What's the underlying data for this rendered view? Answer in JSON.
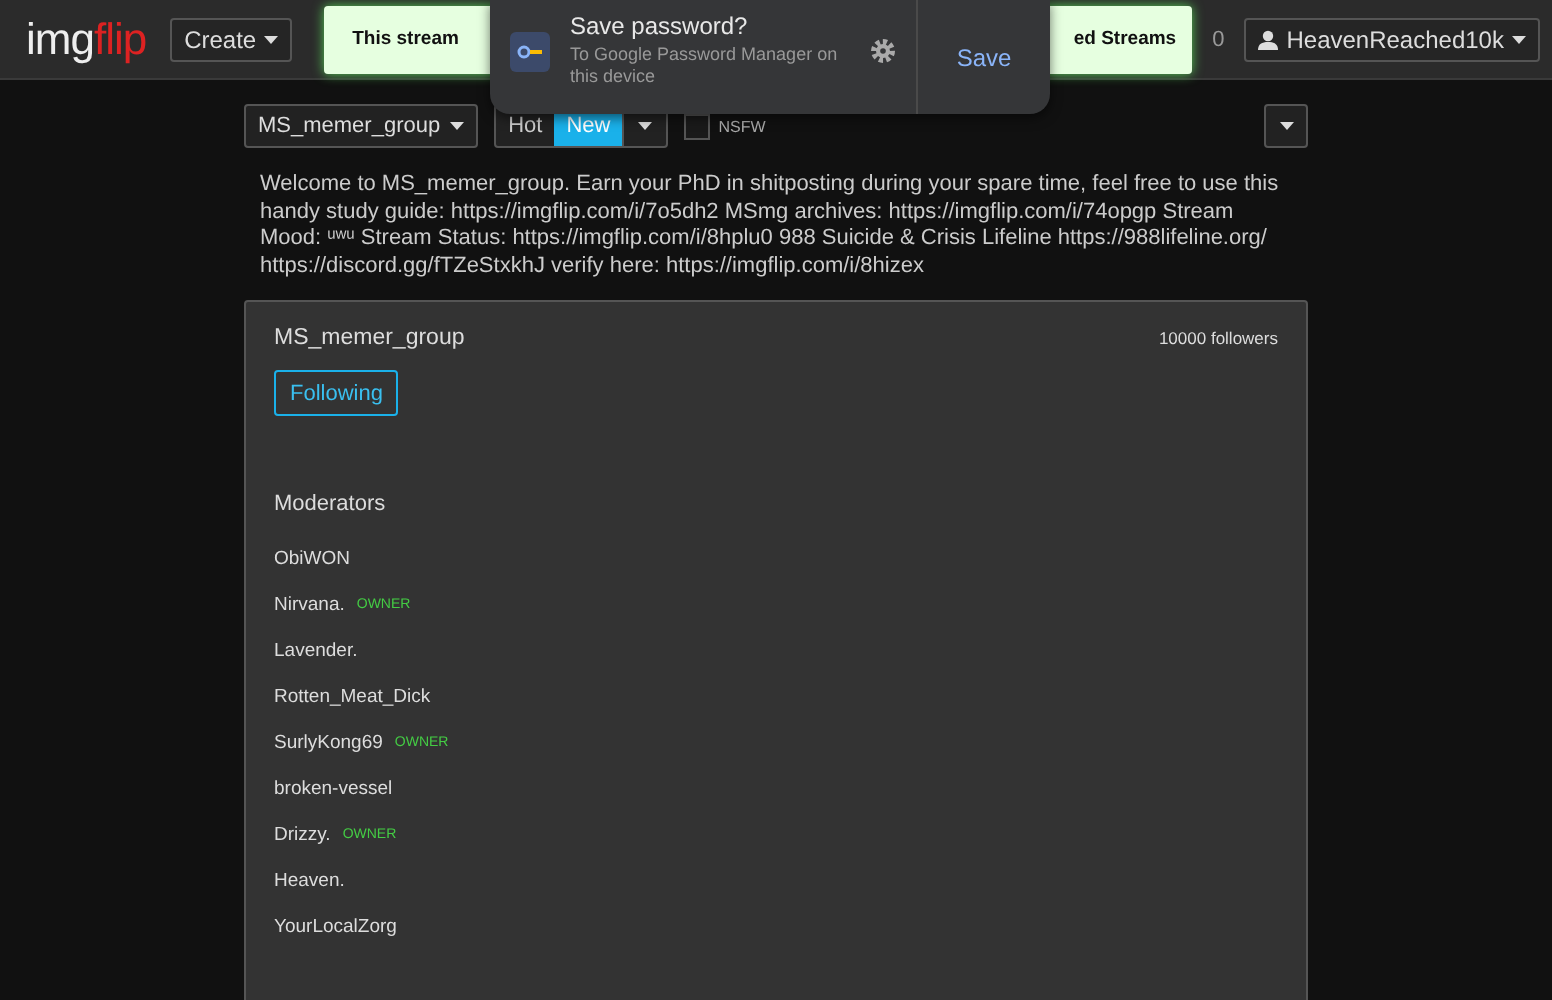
{
  "header": {
    "logo": {
      "part_1": "img",
      "part_2": "flip"
    },
    "create_button": "Create",
    "banner": {
      "text_start": "This stream",
      "text_end": "ed Streams"
    },
    "notification_count": "0",
    "user": "HeavenReached10k"
  },
  "password_popup": {
    "title": "Save password?",
    "subtitle": "To Google Password Manager on this device",
    "save_button": "Save"
  },
  "toolbar": {
    "stream_select": "MS_memer_group",
    "sort_options": [
      {
        "label": "Hot",
        "selected": false
      },
      {
        "label": "New",
        "selected": true
      }
    ],
    "nsfw": {
      "label": "NSFW",
      "checked": false
    }
  },
  "description": "Welcome to MS_memer_group. Earn your PhD in shitposting during your spare time, feel free to use this handy study guide: https://imgflip.com/i/7o5dh2 MSmg archives: https://imgflip.com/i/74opgp Stream Mood: ᵘʷᵘ Stream Status: https://imgflip.com/i/8hplu0 988 Suicide & Crisis Lifeline https://988lifeline.org/ https://discord.gg/fTZeStxkhJ verify here: https://imgflip.com/i/8hizex",
  "stream_card": {
    "title": "MS_memer_group",
    "followers": "10000 followers",
    "follow_button": {
      "label": "Following",
      "following": true
    },
    "moderators_heading": "Moderators",
    "moderators": [
      {
        "name": "ObiWON"
      },
      {
        "name": "Nirvana.",
        "badge": "OWNER"
      },
      {
        "name": "Lavender."
      },
      {
        "name": "Rotten_Meat_Dick"
      },
      {
        "name": "SurlyKong69",
        "badge": "OWNER"
      },
      {
        "name": "broken-vessel"
      },
      {
        "name": "Drizzy.",
        "badge": "OWNER"
      },
      {
        "name": "Heaven."
      },
      {
        "name": "YourLocalZorg"
      }
    ]
  }
}
